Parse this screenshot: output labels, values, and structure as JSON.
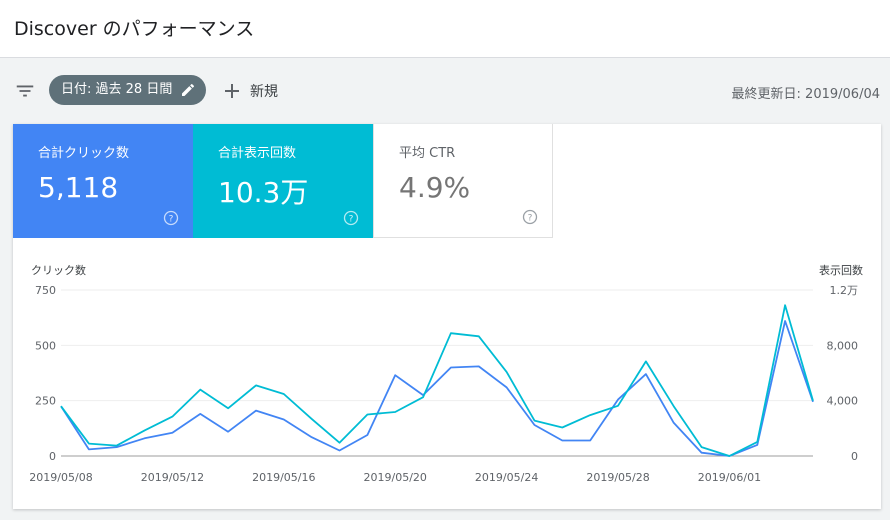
{
  "header": {
    "title": "Discover のパフォーマンス"
  },
  "toolbar": {
    "filter_icon": "filter-list-icon",
    "date_chip_label": "日付: 過去 28 日間",
    "new_label": "新規",
    "last_updated": "最終更新日: 2019/06/04"
  },
  "metrics": [
    {
      "label": "合計クリック数",
      "value": "5,118"
    },
    {
      "label": "合計表示回数",
      "value": "10.3万"
    },
    {
      "label": "平均 CTR",
      "value": "4.9%"
    }
  ],
  "colors": {
    "clicks": "#4285f4",
    "impressions": "#00bcd4",
    "header_bg": "#ffffff",
    "chip_bg": "#5f7179"
  },
  "chart_data": {
    "type": "line",
    "ylabel": "クリック数",
    "y2label": "表示回数",
    "ylim": [
      0,
      750
    ],
    "y2lim": [
      0,
      12000
    ],
    "yticks": [
      "0",
      "250",
      "500",
      "750"
    ],
    "y2ticks": [
      "0",
      "4,000",
      "8,000",
      "1.2万"
    ],
    "grid": true,
    "xticks": [
      "2019/05/08",
      "2019/05/12",
      "2019/05/16",
      "2019/05/20",
      "2019/05/24",
      "2019/05/28",
      "2019/06/01"
    ],
    "x": [
      "2019/05/08",
      "2019/05/09",
      "2019/05/10",
      "2019/05/11",
      "2019/05/12",
      "2019/05/13",
      "2019/05/14",
      "2019/05/15",
      "2019/05/16",
      "2019/05/17",
      "2019/05/18",
      "2019/05/19",
      "2019/05/20",
      "2019/05/21",
      "2019/05/22",
      "2019/05/23",
      "2019/05/24",
      "2019/05/25",
      "2019/05/26",
      "2019/05/27",
      "2019/05/28",
      "2019/05/29",
      "2019/05/30",
      "2019/05/31",
      "2019/06/01",
      "2019/06/02",
      "2019/06/03",
      "2019/06/04"
    ],
    "series": [
      {
        "name": "クリック数",
        "axis": "left",
        "color": "#4285f4",
        "values": [
          225,
          30,
          40,
          80,
          105,
          190,
          110,
          205,
          165,
          85,
          25,
          95,
          365,
          275,
          400,
          405,
          310,
          140,
          70,
          70,
          255,
          370,
          150,
          15,
          0,
          50,
          610,
          245
        ]
      },
      {
        "name": "表示回数",
        "axis": "right",
        "color": "#00bcd4",
        "values": [
          3600,
          900,
          750,
          1850,
          2850,
          4800,
          3450,
          5100,
          4480,
          2680,
          960,
          3000,
          3180,
          4250,
          8880,
          8650,
          6080,
          2560,
          2060,
          2960,
          3630,
          6840,
          3600,
          640,
          0,
          1020,
          10900,
          4000
        ]
      }
    ]
  }
}
